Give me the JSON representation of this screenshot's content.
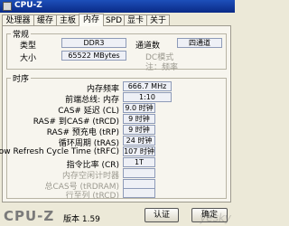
{
  "window": {
    "title": "CPU-Z"
  },
  "tabs": [
    {
      "label": "处理器"
    },
    {
      "label": "缓存"
    },
    {
      "label": "主板"
    },
    {
      "label": "内存"
    },
    {
      "label": "SPD"
    },
    {
      "label": "显卡"
    },
    {
      "label": "关于"
    }
  ],
  "active_tab": "内存",
  "general": {
    "title": "常规",
    "type_label": "类型",
    "type_value": "DDR3",
    "size_label": "大小",
    "size_value": "65522 MBytes",
    "channels_label": "通道数",
    "channels_value": "四通道",
    "dc_mode_label": "DC模式",
    "nb_freq_label": "注：频率"
  },
  "timings": {
    "title": "时序",
    "rows": [
      {
        "label": "内存频率",
        "value": "666.7 MHz"
      },
      {
        "label": "前端总线: 内存",
        "value": "1:10"
      },
      {
        "label": "CAS# 延迟 (CL)",
        "value": "9.0 时钟"
      },
      {
        "label": "RAS# 到CAS# (tRCD)",
        "value": "9 时钟"
      },
      {
        "label": "RAS# 预充电 (tRP)",
        "value": "9 时钟"
      },
      {
        "label": "循环周期 (tRAS)",
        "value": "24 时钟"
      },
      {
        "label": "Row Refresh Cycle Time (tRFC)",
        "value": "107 时钟"
      },
      {
        "label": "指令比率 (CR)",
        "value": "1T"
      },
      {
        "label": "内存空闲计时器",
        "value": ""
      },
      {
        "label": "总CAS号 (tRDRAM)",
        "value": ""
      },
      {
        "label": "行至列 (tRCD)",
        "value": ""
      }
    ]
  },
  "footer": {
    "brand": "CPU-Z",
    "version_label": "版本 1.59",
    "ok_button": "认证",
    "confirm_button": "确定"
  },
  "watermark": "yesky"
}
